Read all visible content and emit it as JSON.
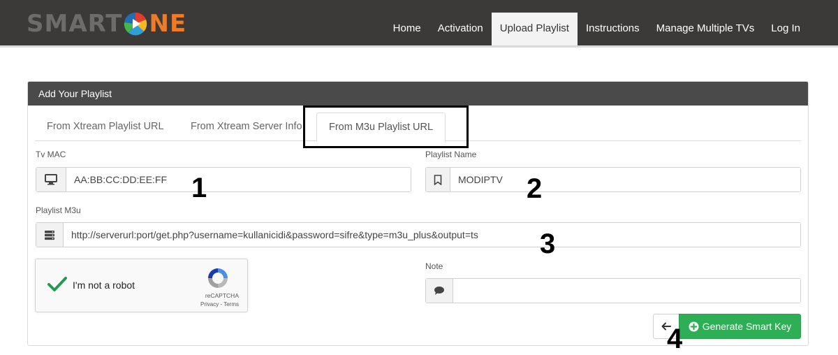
{
  "brand": {
    "logo_left": "SMART",
    "logo_right": "NE",
    "logo_letter": "O"
  },
  "nav": {
    "items": [
      {
        "label": "Home",
        "active": false
      },
      {
        "label": "Activation",
        "active": false
      },
      {
        "label": "Upload Playlist",
        "active": true
      },
      {
        "label": "Instructions",
        "active": false
      },
      {
        "label": "Manage Multiple TVs",
        "active": false
      },
      {
        "label": "Log In",
        "active": false
      }
    ]
  },
  "panel": {
    "title": "Add Your Playlist",
    "tabs": [
      {
        "label": "From Xtream Playlist URL",
        "active": false
      },
      {
        "label": "From Xtream Server Info",
        "active": false
      },
      {
        "label": "From M3u Playlist URL",
        "active": true
      }
    ]
  },
  "form": {
    "tv_mac": {
      "label": "Tv MAC",
      "value": "AA:BB:CC:DD:EE:FF",
      "icon": "monitor-icon"
    },
    "playlist_name": {
      "label": "Playlist Name",
      "value": "MODIPTV",
      "icon": "bookmark-icon"
    },
    "playlist_m3u": {
      "label": "Playlist M3u",
      "value": "http://serverurl:port/get.php?username=kullanicidi&password=sifre&type=m3u_plus&output=ts",
      "icon": "server-icon"
    },
    "note": {
      "label": "Note",
      "value": "",
      "icon": "comment-icon"
    }
  },
  "captcha": {
    "label": "I'm not a robot",
    "brand": "reCAPTCHA",
    "terms": "Privacy - Terms"
  },
  "actions": {
    "generate_label": "Generate Smart Key"
  },
  "annotations": [
    "1",
    "2",
    "3",
    "4"
  ],
  "colors": {
    "topbar": "#3c3a39",
    "accent_green": "#2eaf55",
    "logo_orange": "#f07b26"
  }
}
